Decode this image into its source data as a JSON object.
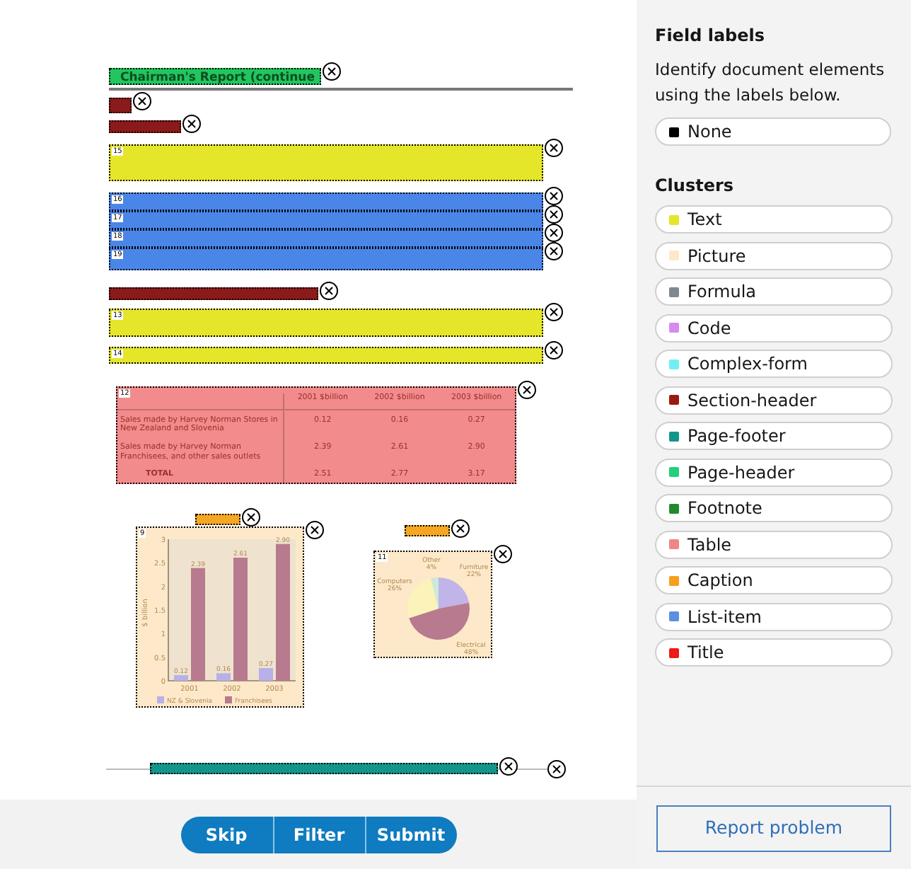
{
  "document": {
    "annotations": [
      {
        "kind": "page-header",
        "color": "#22c55e",
        "text": "Chairman's Report (continue"
      },
      {
        "kind": "section-header",
        "color": "#8b1a1a"
      },
      {
        "kind": "section-header",
        "color": "#8b1a1a"
      },
      {
        "kind": "text",
        "color": "#e5e52a",
        "number": "15"
      },
      {
        "kind": "list-item",
        "color": "#4a86e8",
        "number": "16"
      },
      {
        "kind": "list-item",
        "color": "#4a86e8",
        "number": "17"
      },
      {
        "kind": "list-item",
        "color": "#4a86e8",
        "number": "18"
      },
      {
        "kind": "list-item",
        "color": "#4a86e8",
        "number": "19"
      },
      {
        "kind": "section-header",
        "color": "#8b1a1a"
      },
      {
        "kind": "text",
        "color": "#e5e52a",
        "number": "13"
      },
      {
        "kind": "text",
        "color": "#e5e52a",
        "number": "14"
      },
      {
        "kind": "table",
        "color": "#f28b8b",
        "number": "12",
        "columns": [
          "",
          "2001 $billion",
          "2002 $billion",
          "2003 $billion"
        ],
        "rows": [
          [
            "Sales made by Harvey Norman Stores in New Zealand and Slovenia",
            "0.12",
            "0.16",
            "0.27"
          ],
          [
            "Sales made by Harvey Norman Franchisees, and other sales outlets",
            "2.39",
            "2.61",
            "2.90"
          ],
          [
            "TOTAL",
            "2.51",
            "2.77",
            "3.17"
          ]
        ]
      },
      {
        "kind": "caption",
        "color": "#f5a623"
      },
      {
        "kind": "picture",
        "color": "#fde9c9",
        "number": "9",
        "chart_data": {
          "type": "bar",
          "ylabel": "$ billion",
          "categories": [
            "2001",
            "2002",
            "2003"
          ],
          "series": [
            {
              "name": "NZ & Slovenia",
              "color": "#b8b0e8",
              "values": [
                0.12,
                0.16,
                0.27
              ]
            },
            {
              "name": "Franchisees",
              "color": "#b87a8e",
              "values": [
                2.39,
                2.61,
                2.9
              ]
            }
          ],
          "legend": "bottom",
          "ylim": [
            0,
            3
          ],
          "yticks": [
            0,
            0.5,
            1,
            1.5,
            2,
            2.5,
            3
          ],
          "value_labels": [
            [
              "0.12",
              "0.16",
              "0.27"
            ],
            [
              "2.39",
              "2.61",
              "2.90"
            ]
          ]
        }
      },
      {
        "kind": "caption",
        "color": "#f5a623"
      },
      {
        "kind": "picture",
        "color": "#fde9c9",
        "number": "11",
        "chart_data": {
          "type": "pie",
          "categories": [
            "Furniture",
            "Electrical",
            "Computers",
            "Other"
          ],
          "values": [
            22,
            48,
            26,
            4
          ],
          "value_labels": [
            "22%",
            "48%",
            "26%",
            "4%"
          ]
        }
      },
      {
        "kind": "page-footer",
        "color": "#14958c"
      }
    ]
  },
  "sidebar": {
    "title": "Field labels",
    "description": "Identify document elements using the labels below.",
    "none_option": {
      "label": "None",
      "color": "#000000"
    },
    "clusters_title": "Clusters",
    "clusters": [
      {
        "label": "Text",
        "color": "#e5e52a"
      },
      {
        "label": "Picture",
        "color": "#fde9c9"
      },
      {
        "label": "Formula",
        "color": "#7f8790"
      },
      {
        "label": "Code",
        "color": "#d88af0"
      },
      {
        "label": "Complex-form",
        "color": "#6ff0f5"
      },
      {
        "label": "Section-header",
        "color": "#9b1a0f"
      },
      {
        "label": "Page-footer",
        "color": "#14958c"
      },
      {
        "label": "Page-header",
        "color": "#22d07a"
      },
      {
        "label": "Footnote",
        "color": "#238a2b"
      },
      {
        "label": "Table",
        "color": "#f08585"
      },
      {
        "label": "Caption",
        "color": "#f5a01e"
      },
      {
        "label": "List-item",
        "color": "#5b8fe0"
      },
      {
        "label": "Title",
        "color": "#f01818"
      }
    ]
  },
  "report_button": "Report problem",
  "actions": [
    "Skip",
    "Filter",
    "Submit"
  ]
}
